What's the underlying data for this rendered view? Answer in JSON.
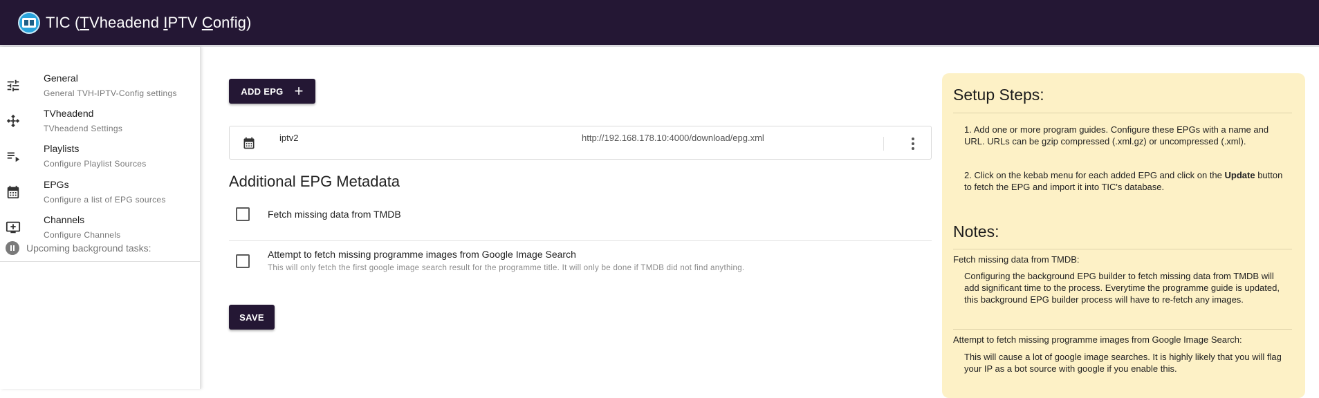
{
  "app": {
    "title_prefix": "TIC (",
    "title_t": "T",
    "title_mid1": "Vheadend ",
    "title_i": "I",
    "title_mid2": "PTV ",
    "title_c": "C",
    "title_suffix": "onfig)"
  },
  "sidebar": {
    "items": [
      {
        "title": "General",
        "subtitle": "General TVH-IPTV-Config settings",
        "icon": "tune-icon"
      },
      {
        "title": "TVheadend",
        "subtitle": "TVheadend Settings",
        "icon": "hub-icon"
      },
      {
        "title": "Playlists",
        "subtitle": "Configure Playlist Sources",
        "icon": "playlist-icon"
      },
      {
        "title": "EPGs",
        "subtitle": "Configure a list of EPG sources",
        "icon": "calendar-icon"
      },
      {
        "title": "Channels",
        "subtitle": "Configure Channels",
        "icon": "add-to-queue-icon"
      }
    ],
    "background_tasks_label": "Upcoming background tasks:"
  },
  "main": {
    "add_epg_label": "ADD EPG",
    "epgs": [
      {
        "name": "iptv2",
        "url": "http://192.168.178.10:4000/download/epg.xml"
      }
    ],
    "section_title": "Additional EPG Metadata",
    "options": [
      {
        "label": "Fetch missing data from TMDB",
        "help": "",
        "checked": false
      },
      {
        "label": "Attempt to fetch missing programme images from Google Image Search",
        "help": "This will only fetch the first google image search result for the programme title. It will only be done if TMDB did not find anything.",
        "checked": false
      }
    ],
    "save_label": "SAVE"
  },
  "help": {
    "setup_title": "Setup Steps:",
    "step1": "1. Add one or more program guides. Configure these EPGs with a name and URL. URLs can be gzip compressed (.xml.gz) or uncompressed (.xml).",
    "step2_pre": "2. Click on the kebab menu for each added EPG and click on the ",
    "step2_bold": "Update",
    "step2_post": " button to fetch the EPG and import it into TIC's database.",
    "notes_title": "Notes:",
    "note1_label": "Fetch missing data from TMDB:",
    "note1_text": "Configuring the background EPG builder to fetch missing data from TMDB will add significant time to the process. Everytime the programme guide is updated, this background EPG builder process will have to re-fetch any images.",
    "note2_label": "Attempt to fetch missing programme images from Google Image Search:",
    "note2_text": "This will cause a lot of google image searches. It is highly likely that you will flag your IP as a bot source with google if you enable this."
  },
  "colors": {
    "appbar": "#241734",
    "accent_button": "#241734",
    "help_panel": "#fdf1c6"
  }
}
